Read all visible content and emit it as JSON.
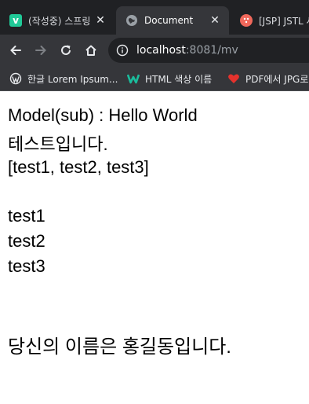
{
  "browser": {
    "tabs": [
      {
        "title": "(작성중) 스프링",
        "favicon": "velog-icon",
        "favicon_letter": "v",
        "favicon_color": "#20c997",
        "active": false
      },
      {
        "title": "Document",
        "favicon": "globe-icon",
        "active": true
      },
      {
        "title": "[JSP] JSTL 사용",
        "favicon": "tistory-icon",
        "favicon_color": "#f0685b",
        "active": false
      }
    ],
    "close_glyph": "✕",
    "address": {
      "host": "localhost",
      "rest": ":8081/mv"
    },
    "bookmarks": [
      {
        "label": "한글 Lorem Ipsum...",
        "icon": "wordpress-icon"
      },
      {
        "label": "HTML 색상 이름",
        "icon": "w-logo-icon",
        "icon_color": "#1abc9c"
      },
      {
        "label": "PDF에서 JPG로",
        "icon": "heart-icon",
        "icon_color": "#e5322d"
      }
    ]
  },
  "page": {
    "model_line": "Model(sub) : Hello World",
    "test_line": "테스트입니다.",
    "list_line": "[test1, test2, test3]",
    "items": [
      "test1",
      "test2",
      "test3"
    ],
    "name_line": "당신의 이름은 홍길동입니다."
  },
  "colors": {
    "tabstrip_bg": "#202124",
    "toolbar_bg": "#35363a",
    "page_bg": "#ffffff"
  }
}
